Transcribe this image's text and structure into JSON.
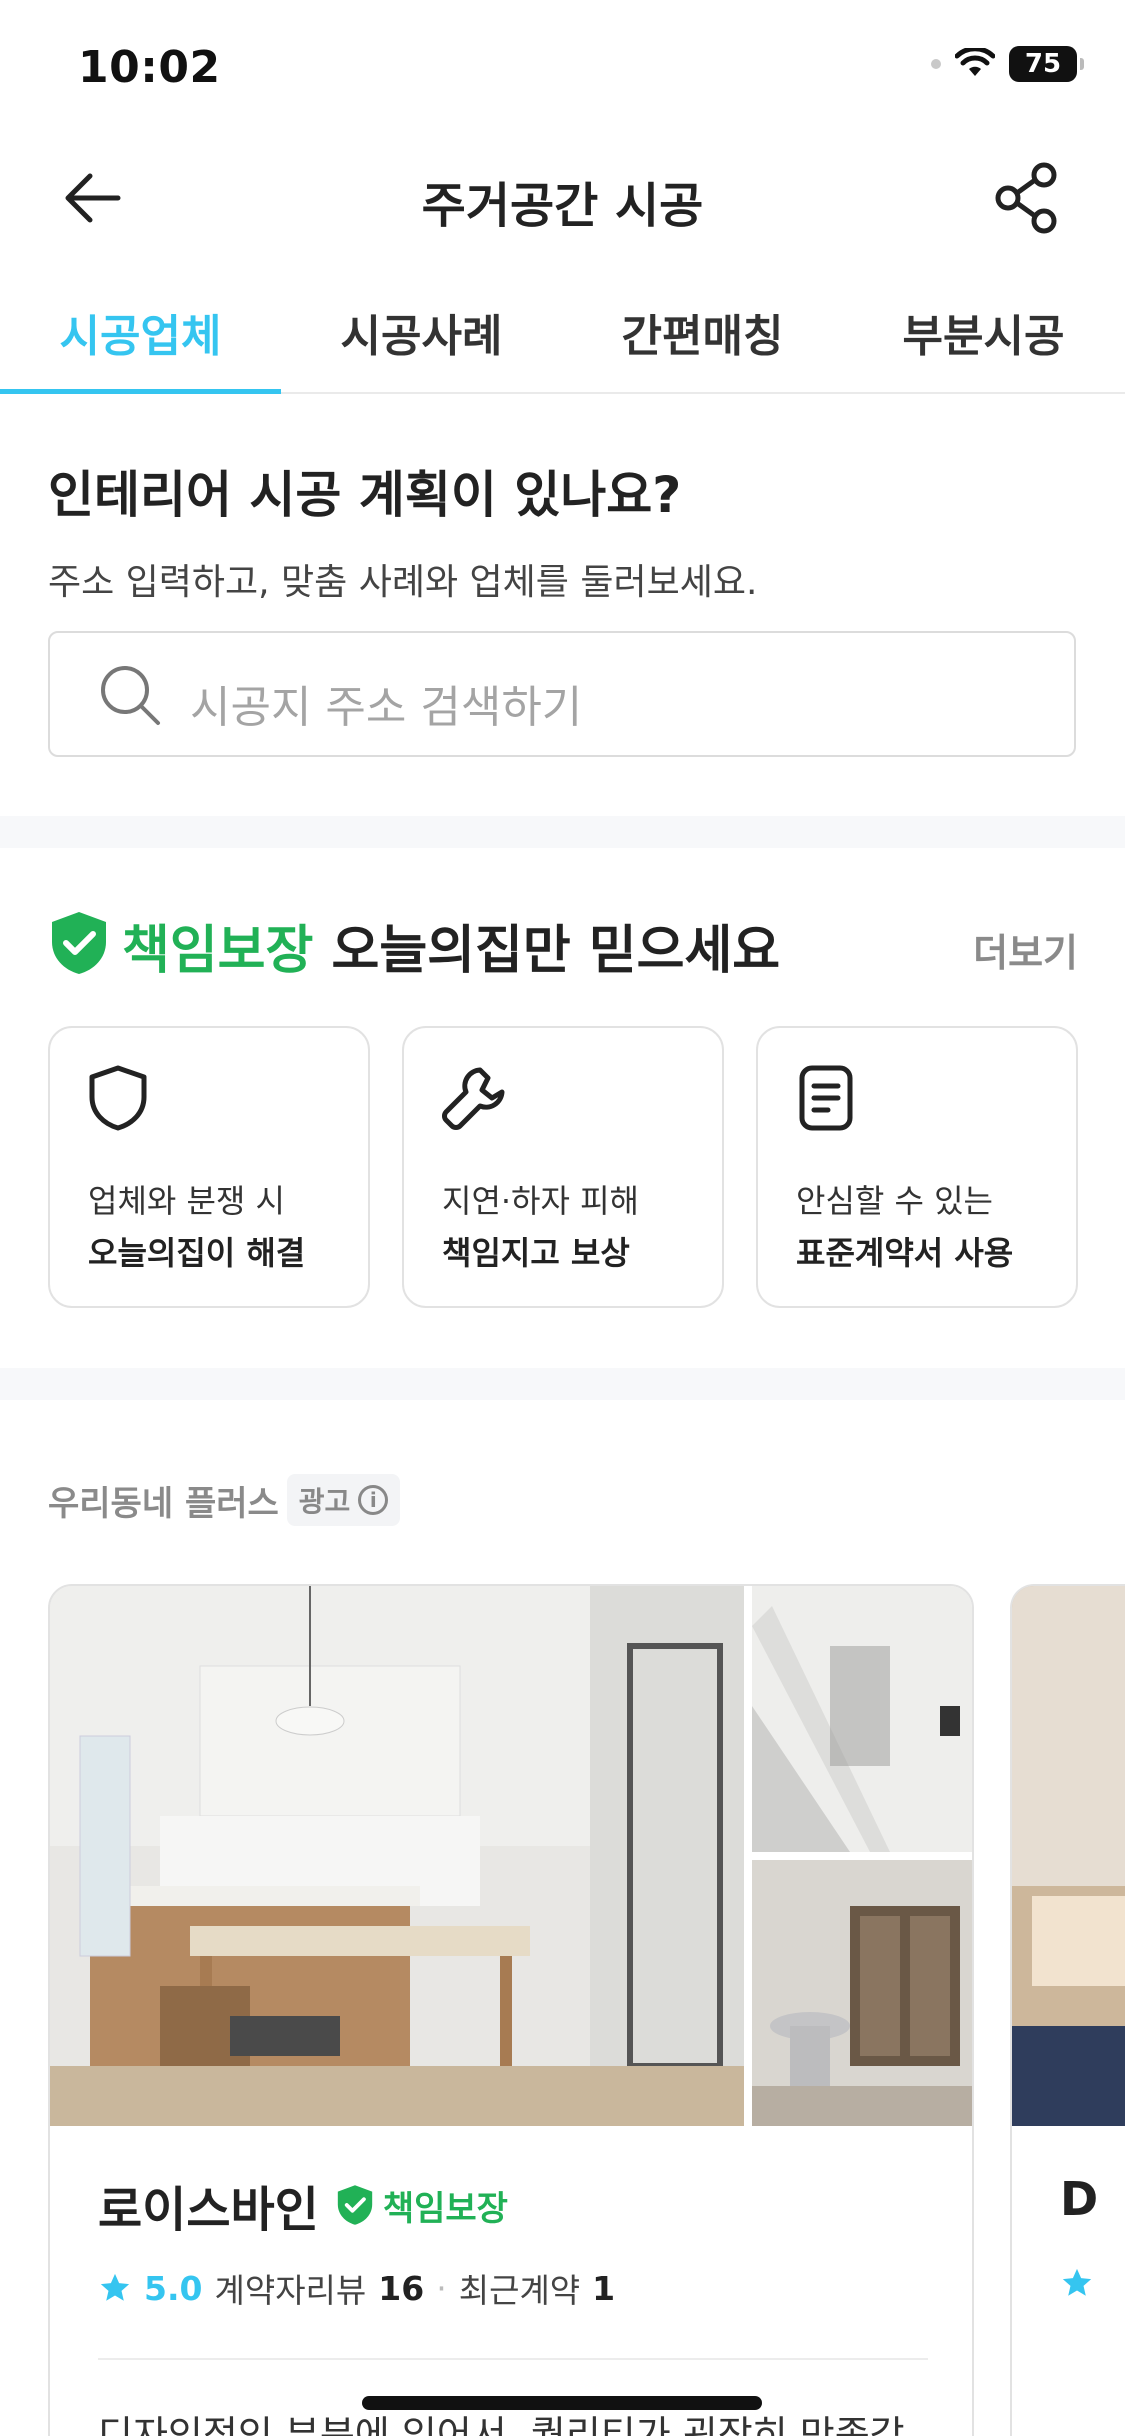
{
  "status_bar": {
    "time": "10:02",
    "battery": "75"
  },
  "header": {
    "title": "주거공간 시공"
  },
  "tabs": [
    {
      "label": "시공업체",
      "active": true
    },
    {
      "label": "시공사례",
      "active": false
    },
    {
      "label": "간편매칭",
      "active": false
    },
    {
      "label": "부분시공",
      "active": false
    }
  ],
  "plan": {
    "title": "인테리어 시공 계획이 있나요?",
    "subtitle": "주소 입력하고, 맞춤 사례와 업체를 둘러보세요.",
    "search_placeholder": "시공지 주소 검색하기"
  },
  "guarantee": {
    "highlight": "책임보장",
    "title_rest": " 오늘의집만 믿으세요",
    "more": "더보기",
    "cards": [
      {
        "icon": "shield-icon",
        "line1": "업체와 분쟁 시",
        "line2": "오늘의집이 해결"
      },
      {
        "icon": "wrench-icon",
        "line1": "지연·하자 피해",
        "line2": "책임지고 보상"
      },
      {
        "icon": "document-icon",
        "line1": "안심할 수 있는",
        "line2": "표준계약서 사용"
      }
    ]
  },
  "plus": {
    "label": "우리동네 플러스",
    "ad": "광고"
  },
  "vendor": {
    "name": "로이스바인",
    "badge": "책임보장",
    "rating": "5.0",
    "reviews_label": "계약자리뷰",
    "reviews_count": "16",
    "recent_label": "최근계약",
    "recent_count": "1",
    "review": "디자인적인 부분에 있어서, 퀄리티가 굉장히 만족감이 있었습니다. 다른 유튜 업체들과도 비교도"
  },
  "next_vendor": {
    "initial": "D"
  },
  "colors": {
    "accent": "#35c5f0",
    "guarantee_green": "#21b156"
  }
}
